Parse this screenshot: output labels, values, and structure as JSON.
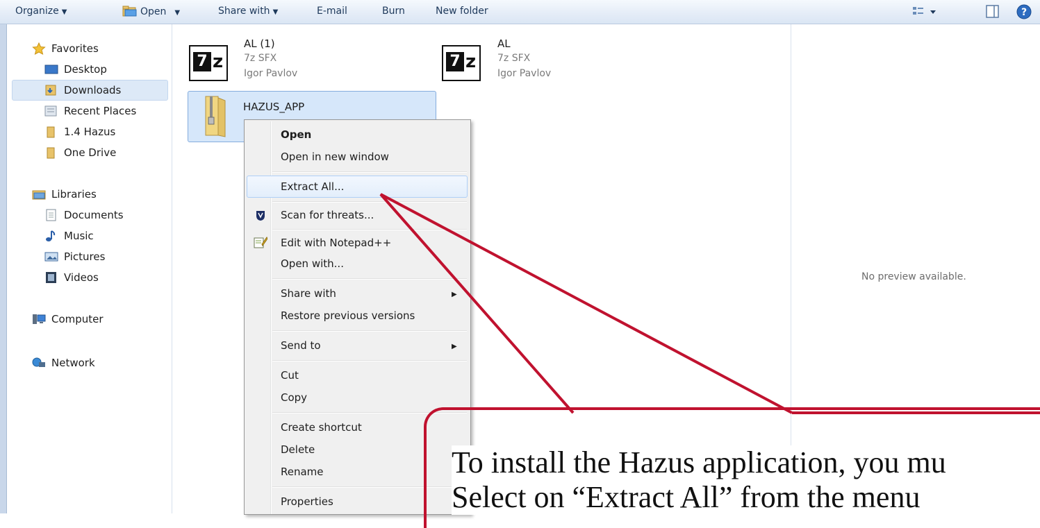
{
  "toolbar": {
    "organize": "Organize",
    "open": "Open",
    "share_with": "Share with",
    "email": "E-mail",
    "burn": "Burn",
    "new_folder": "New folder"
  },
  "nav": {
    "favorites": "Favorites",
    "desktop": "Desktop",
    "downloads": "Downloads",
    "recent_places": "Recent Places",
    "hazus_14": "1.4 Hazus",
    "one_drive": "One Drive",
    "libraries": "Libraries",
    "documents": "Documents",
    "music": "Music",
    "pictures": "Pictures",
    "videos": "Videos",
    "computer": "Computer",
    "network": "Network"
  },
  "files": [
    {
      "name": "AL (1)",
      "type": "7z SFX",
      "author": "Igor Pavlov"
    },
    {
      "name": "AL",
      "type": "7z SFX",
      "author": "Igor Pavlov"
    },
    {
      "name": "HAZUS_APP"
    }
  ],
  "preview": {
    "text": "No preview available."
  },
  "context_menu": {
    "open": "Open",
    "open_new_window": "Open in new window",
    "extract_all": "Extract All...",
    "scan": "Scan for threats...",
    "edit_notepad": "Edit with Notepad++",
    "open_with": "Open with...",
    "share_with": "Share with",
    "restore": "Restore previous versions",
    "send_to": "Send to",
    "cut": "Cut",
    "copy": "Copy",
    "create_shortcut": "Create shortcut",
    "delete": "Delete",
    "rename": "Rename",
    "properties": "Properties"
  },
  "annotation": {
    "line1": "To install the Hazus application, you mu",
    "line2": "Select on “Extract All” from the menu",
    "color": "#c0122f"
  },
  "colors": {
    "selection": "#d6e7fa",
    "menu_bg": "#f0f0f0",
    "toolbar_text": "#1e395b"
  }
}
